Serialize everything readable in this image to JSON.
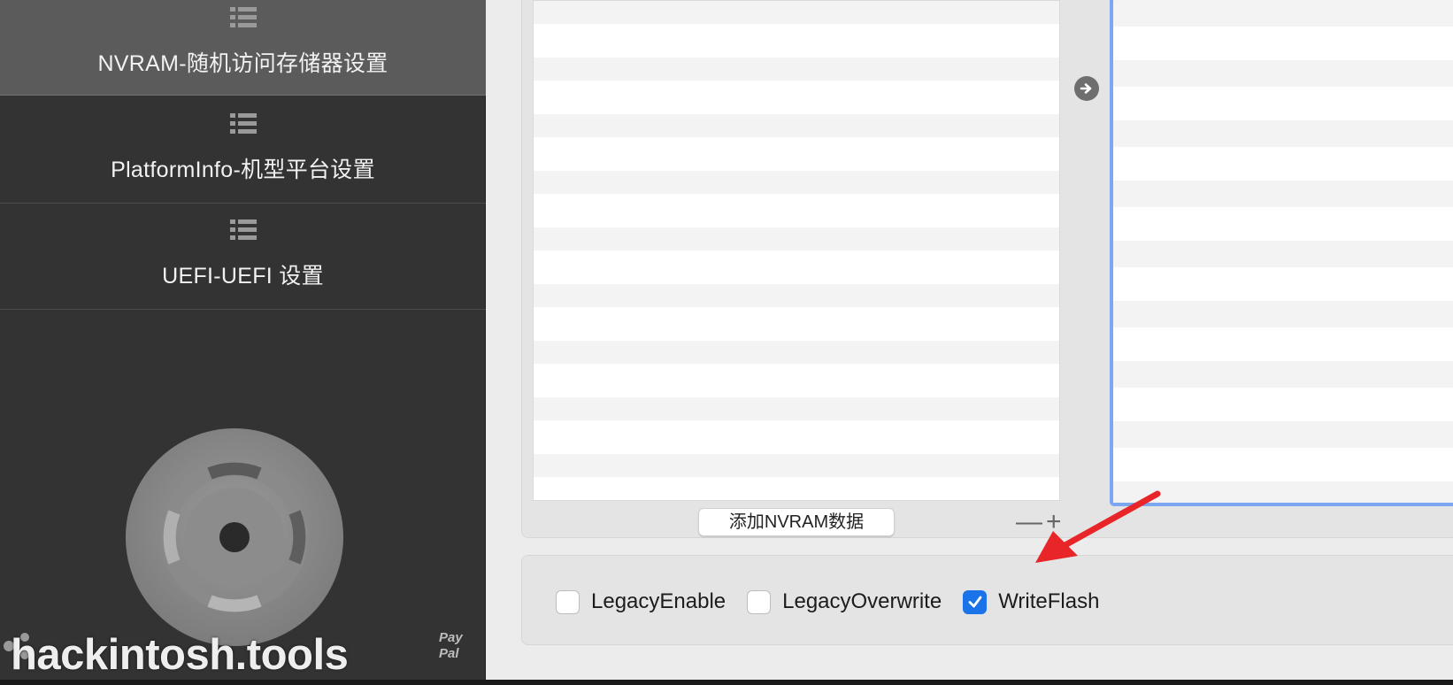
{
  "sidebar": {
    "items": [
      {
        "label": "NVRAM-随机访问存储器设置",
        "icon": "list-icon",
        "active": true
      },
      {
        "label": "PlatformInfo-机型平台设置",
        "icon": "list-icon",
        "active": false
      },
      {
        "label": "UEFI-UEFI 设置",
        "icon": "list-icon",
        "active": false
      }
    ],
    "brand": "hackintosh.tools",
    "paypal": {
      "line1": "Pay",
      "line2": "Pal"
    }
  },
  "nvram": {
    "add_button_label": "添加NVRAM数据",
    "remove_symbol": "—",
    "add_symbol": "+",
    "move_icon": "arrow-right-circle-icon"
  },
  "options": {
    "checkboxes": [
      {
        "label": "LegacyEnable",
        "checked": false
      },
      {
        "label": "LegacyOverwrite",
        "checked": false
      },
      {
        "label": "WriteFlash",
        "checked": true
      }
    ]
  },
  "colors": {
    "sidebar_bg": "#333333",
    "sidebar_active": "#5b5b5b",
    "focus_ring": "#7aa7ef",
    "checkbox_checked": "#1a73e8",
    "annotation_arrow": "#e8262a"
  }
}
